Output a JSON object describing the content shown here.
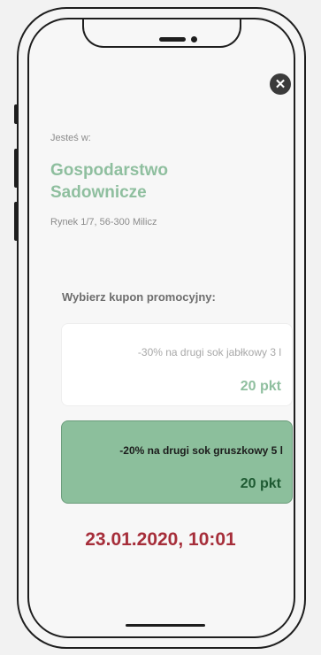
{
  "header": {
    "close_icon": "close-icon"
  },
  "location": {
    "intro_label": "Jesteś w:",
    "name": "Gospodarstwo Sadownicze",
    "address": "Rynek 1/7, 56-300 Milicz"
  },
  "coupons": {
    "title": "Wybierz kupon promocyjny:",
    "items": [
      {
        "description": "-30% na drugi sok jabłkowy 3 l",
        "points": "20 pkt",
        "selected": false
      },
      {
        "description": "-20% na drugi sok gruszkowy 5 l",
        "points": "20 pkt",
        "selected": true
      }
    ]
  },
  "timestamp": "23.01.2020, 10:01",
  "colors": {
    "accent_green": "#8fbf9f",
    "selected_coupon_bg": "#8cbf9c",
    "points_dark_green": "#1e5a32",
    "timestamp_red": "#a62e3a"
  }
}
